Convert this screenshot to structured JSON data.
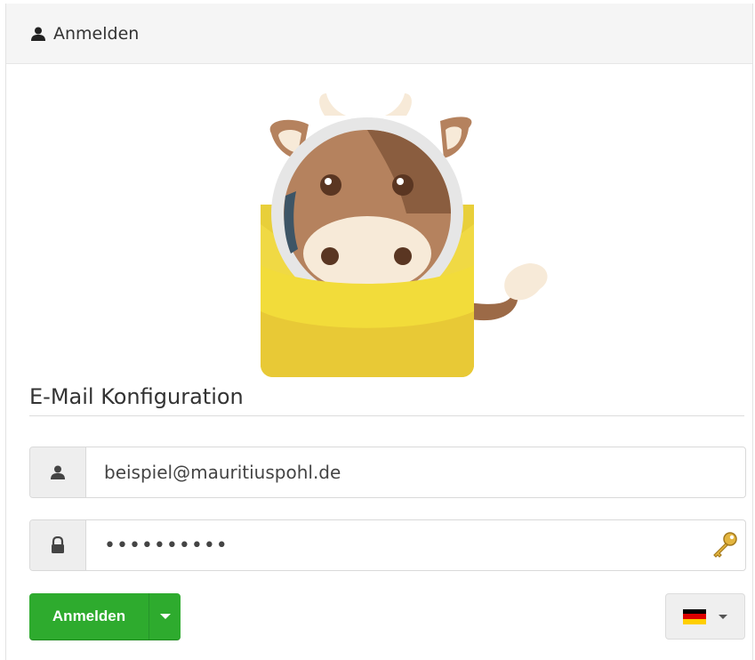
{
  "header": {
    "title": "Anmelden",
    "icon": "user-icon"
  },
  "logo": {
    "icon": "cow-envelope-logo"
  },
  "section": {
    "title": "E-Mail Konfiguration"
  },
  "email": {
    "value": "beispiel@mauritiuspohl.de",
    "icon": "user-icon"
  },
  "password": {
    "value": "••••••••••",
    "icon": "lock-icon",
    "manager_icon": "key-icon"
  },
  "login_button": {
    "label": "Anmelden",
    "color": "#2eab2e"
  },
  "language": {
    "selected": "de",
    "flag_colors": [
      "#000000",
      "#dd0000",
      "#ffce00"
    ]
  }
}
